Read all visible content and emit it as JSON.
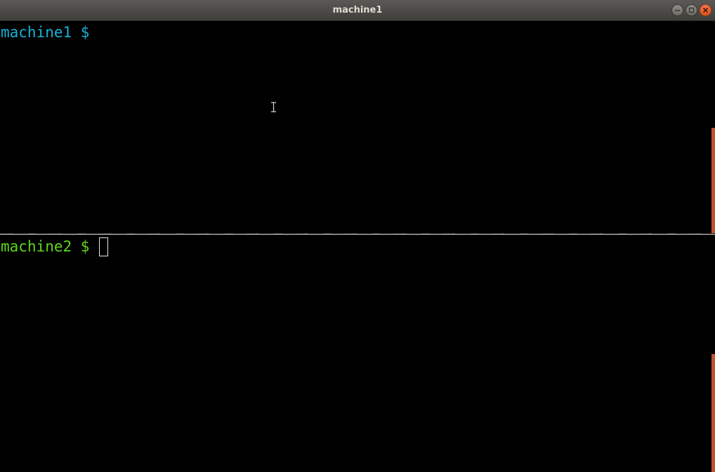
{
  "window": {
    "title": "machine1",
    "controls": [
      {
        "name": "minimize",
        "icon": "minimize-icon"
      },
      {
        "name": "maximize",
        "icon": "maximize-icon"
      },
      {
        "name": "close",
        "icon": "close-icon"
      }
    ]
  },
  "panes": [
    {
      "id": "top",
      "prompt": "machine1 $ ",
      "color": "#18b2d6"
    },
    {
      "id": "bottom",
      "prompt": "machine2 $ ",
      "color": "#5fd61e"
    }
  ],
  "colors": {
    "background": "#000000",
    "scrollbar": "#c0542b",
    "titlebar": "#4a4945"
  },
  "mouse_cursor": "ibeam-cursor"
}
